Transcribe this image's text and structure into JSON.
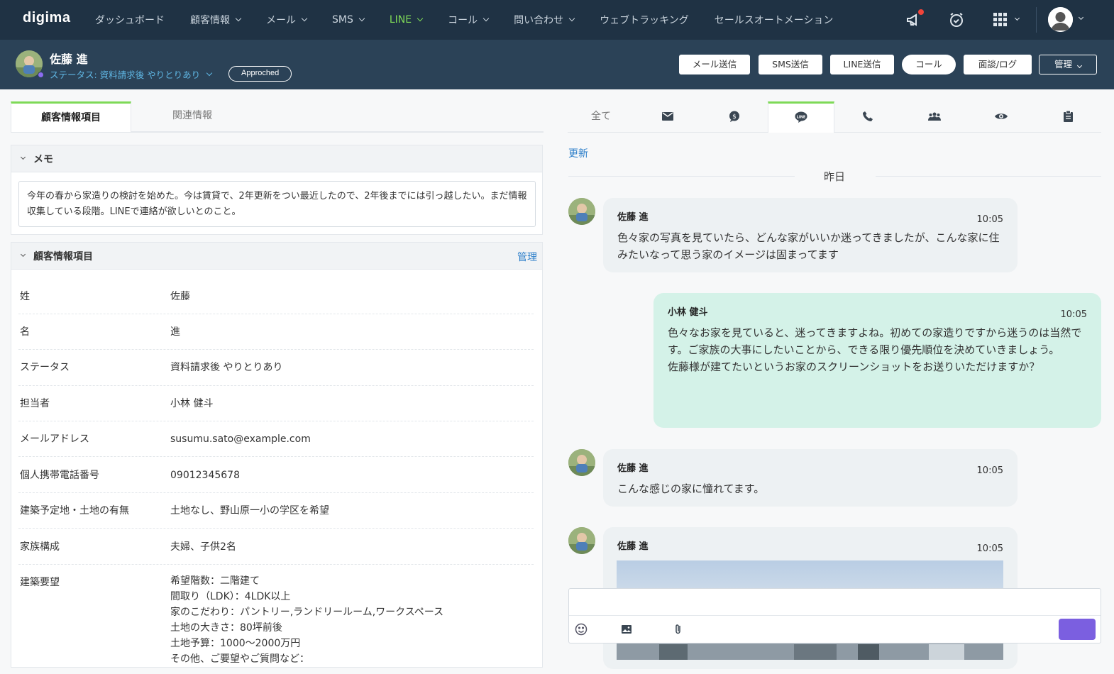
{
  "app": {
    "logo": "digima"
  },
  "nav": {
    "items": [
      {
        "label": "ダッシュボード",
        "dropdown": false,
        "active": false
      },
      {
        "label": "顧客情報",
        "dropdown": true,
        "active": false
      },
      {
        "label": "メール",
        "dropdown": true,
        "active": false
      },
      {
        "label": "SMS",
        "dropdown": true,
        "active": false
      },
      {
        "label": "LINE",
        "dropdown": true,
        "active": true
      },
      {
        "label": "コール",
        "dropdown": true,
        "active": false
      },
      {
        "label": "問い合わせ",
        "dropdown": true,
        "active": false
      },
      {
        "label": "ウェブトラッキング",
        "dropdown": false,
        "active": false
      },
      {
        "label": "セールスオートメーション",
        "dropdown": false,
        "active": false
      }
    ],
    "icons": [
      "megaphone-icon",
      "alarm-clock-icon",
      "apps-grid-icon",
      "user-avatar-icon"
    ]
  },
  "customer": {
    "name": "佐藤 進",
    "status": "ステータス: 資料請求後 やりとりあり",
    "badge": "Approched"
  },
  "actions": {
    "mail": "メール送信",
    "sms": "SMS送信",
    "line": "LINE送信",
    "call": "コール",
    "meeting": "面談/ログ",
    "manage": "管理"
  },
  "left_tabs": {
    "info": "顧客情報項目",
    "related": "関連情報"
  },
  "memo": {
    "title": "メモ",
    "text": "今年の春から家造りの検討を始めた。今は賃貸で、2年更新をつい最近したので、2年後までには引っ越したい。まだ情報収集している段階。LINEで連絡が欲しいとのこと。"
  },
  "fields": {
    "title": "顧客情報項目",
    "manage": "管理",
    "rows": [
      {
        "key": "姓",
        "value": "佐藤"
      },
      {
        "key": "名",
        "value": "進"
      },
      {
        "key": "ステータス",
        "value": "資料請求後 やりとりあり"
      },
      {
        "key": "担当者",
        "value": " 小林 健斗"
      },
      {
        "key": "メールアドレス",
        "value": "susumu.sato@example.com"
      },
      {
        "key": "個人携帯電話番号",
        "value": "09012345678"
      },
      {
        "key": "建築予定地・土地の有無",
        "value": "土地なし、野山原一小の学区を希望"
      },
      {
        "key": "家族構成",
        "value": "夫婦、子供2名"
      },
      {
        "key": "建築要望",
        "value": "希望階数：二階建て\n間取り（LDK）：4LDK以上\n家のこだわり：パントリー,ランドリールーム,ワークスペース\n土地の大きさ：80坪前後\n土地予算：1000〜2000万円\nその他、ご要望やご質問など："
      }
    ]
  },
  "right_tabs": {
    "all": "全て",
    "icons": [
      "mail-icon",
      "sms-icon",
      "line-icon",
      "phone-icon",
      "meeting-icon",
      "view-icon",
      "clipboard-icon"
    ],
    "active": "line-icon"
  },
  "chat": {
    "refresh": "更新",
    "day": "昨日",
    "messages": [
      {
        "sender": "佐藤 進",
        "time": "10:05",
        "direction": "in",
        "text": "色々家の写真を見ていたら、どんな家がいいか迷ってきましたが、こんな家に住みたいなって思う家のイメージは固まってます"
      },
      {
        "sender": "小林 健斗",
        "time": "10:05",
        "direction": "out",
        "text": "色々なお家を見ていると、迷ってきますよね。初めての家造りですから迷うのは当然です。ご家族の大事にしたいことから、できる限り優先順位を決めていきましょう。\n佐藤様が建てたいというお家のスクリーンショットをお送りいただけますか？"
      },
      {
        "sender": "佐藤 進",
        "time": "10:05",
        "direction": "in",
        "text": "こんな感じの家に憧れてます。"
      },
      {
        "sender": "佐藤 進",
        "time": "10:05",
        "direction": "in",
        "text": ""
      }
    ]
  },
  "composer": {
    "icons": [
      "emoji-icon",
      "image-icon",
      "attachment-icon"
    ]
  },
  "colors": {
    "nav_bg": "#1f3244",
    "header_bg": "#2b4257",
    "accent_green": "#7ed957",
    "link_blue": "#2a7dc9",
    "send_purple": "#7b5fe0",
    "bubble_out": "#d4f2e8"
  }
}
